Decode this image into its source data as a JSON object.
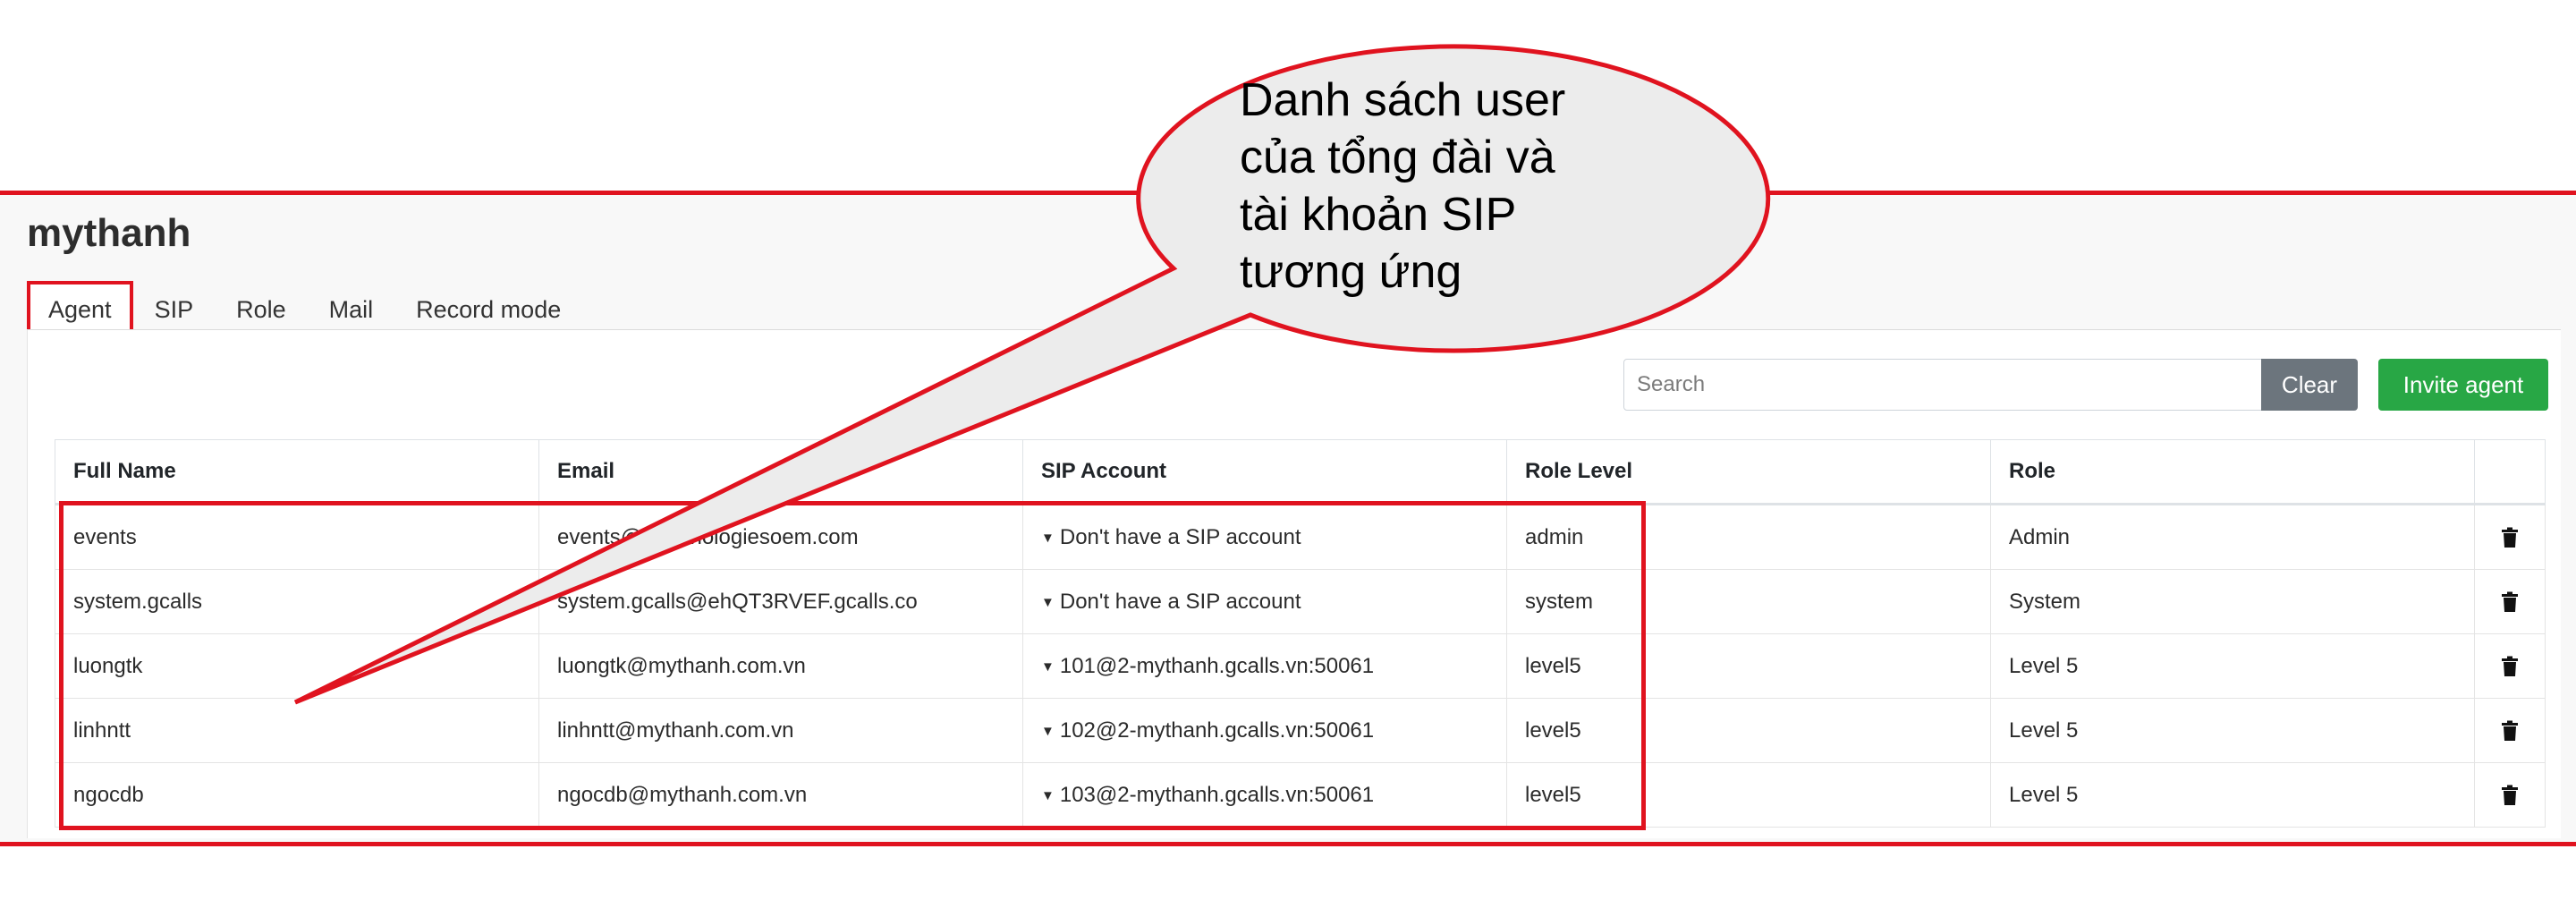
{
  "app": {
    "title": "mythanh"
  },
  "tabs": [
    {
      "label": "Agent",
      "active": true
    },
    {
      "label": "SIP"
    },
    {
      "label": "Role"
    },
    {
      "label": "Mail"
    },
    {
      "label": "Record mode"
    }
  ],
  "toolbar": {
    "search_placeholder": "Search",
    "search_value": "",
    "clear_label": "Clear",
    "invite_label": "Invite agent"
  },
  "table": {
    "columns": [
      "Full Name",
      "Email",
      "SIP Account",
      "Role Level",
      "Role",
      ""
    ],
    "rows": [
      {
        "full_name": "events",
        "email": "events@eonnhologiesoem.com",
        "sip": "Don't have a SIP account",
        "role_level": "admin",
        "role": "Admin"
      },
      {
        "full_name": "system.gcalls",
        "email": "system.gcalls@ehQT3RVEF.gcalls.co",
        "sip": "Don't have a SIP account",
        "role_level": "system",
        "role": "System"
      },
      {
        "full_name": "luongtk",
        "email": "luongtk@mythanh.com.vn",
        "sip": "101@2-mythanh.gcalls.vn:50061",
        "role_level": "level5",
        "role": "Level 5"
      },
      {
        "full_name": "linhntt",
        "email": "linhntt@mythanh.com.vn",
        "sip": "102@2-mythanh.gcalls.vn:50061",
        "role_level": "level5",
        "role": "Level 5"
      },
      {
        "full_name": "ngocdb",
        "email": "ngocdb@mythanh.com.vn",
        "sip": "103@2-mythanh.gcalls.vn:50061",
        "role_level": "level5",
        "role": "Level 5"
      }
    ]
  },
  "annotation": {
    "lines": [
      "Danh sách user",
      "của tổng đài và",
      "tài khoản SIP",
      "tương ứng"
    ]
  },
  "icons": {
    "delete": "trash-icon",
    "sip_toggle": "caret-down-icon"
  },
  "colors": {
    "highlight": "#e0131f",
    "clear_button": "#6c757d",
    "invite_button": "#28a745",
    "callout_fill": "#ececec"
  }
}
